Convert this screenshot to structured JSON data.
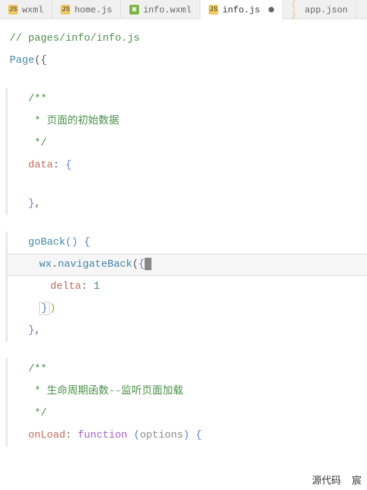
{
  "tabs": [
    {
      "label": "wxml",
      "icon": "js",
      "active": false
    },
    {
      "label": "home.js",
      "icon": "js",
      "active": false
    },
    {
      "label": "info.wxml",
      "icon": "wxml",
      "active": false
    },
    {
      "label": "info.js",
      "icon": "js",
      "active": true,
      "modified": true
    },
    {
      "label": "app.json",
      "icon": "json",
      "active": false
    }
  ],
  "code": {
    "l1": "// pages/info/info.js",
    "l2_page": "Page",
    "l2_open": "({",
    "c1_open": "/**",
    "c1_body": " * 页面的初始数据",
    "c1_close": " */",
    "data_key": "data",
    "colon": ": ",
    "brace_open": "{",
    "brace_close": "}",
    "comma": ",",
    "goback": "goBack",
    "goback_parens": "()",
    "wx": "wx",
    "dot": ".",
    "navback": "navigateBack",
    "paren_open": "(",
    "paren_close": ")",
    "delta_key": "delta",
    "delta_val": "1",
    "c2_open": "/**",
    "c2_body": " * 生命周期函数--监听页面加载",
    "c2_close": " */",
    "onload": "onLoad",
    "function_kw": "function",
    "options": "options"
  },
  "footer": {
    "left": "源代码",
    "right": "宸"
  }
}
